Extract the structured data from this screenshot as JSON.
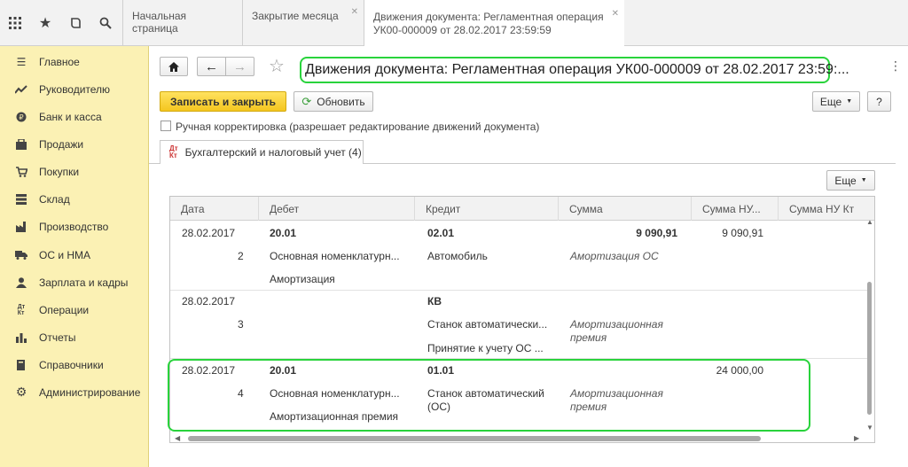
{
  "topbar": {
    "icons": [
      "apps-grid-icon",
      "star-icon",
      "history-icon",
      "search-icon"
    ],
    "tabs": [
      {
        "label": "Начальная страница",
        "closable": false,
        "active": false
      },
      {
        "label": "Закрытие месяца",
        "closable": true,
        "active": false
      },
      {
        "label": "Движения документа: Регламентная операция",
        "label2": "УК00-000009 от 28.02.2017 23:59:59",
        "closable": true,
        "active": true
      }
    ]
  },
  "sidebar": {
    "items": [
      {
        "label": "Главное",
        "icon": "menu-icon"
      },
      {
        "label": "Руководителю",
        "icon": "trend-icon"
      },
      {
        "label": "Банк и касса",
        "icon": "bank-icon"
      },
      {
        "label": "Продажи",
        "icon": "sales-icon"
      },
      {
        "label": "Покупки",
        "icon": "cart-icon"
      },
      {
        "label": "Склад",
        "icon": "warehouse-icon"
      },
      {
        "label": "Производство",
        "icon": "factory-icon"
      },
      {
        "label": "ОС и НМА",
        "icon": "truck-icon"
      },
      {
        "label": "Зарплата и кадры",
        "icon": "person-icon"
      },
      {
        "label": "Операции",
        "icon": "dt-kt-icon"
      },
      {
        "label": "Отчеты",
        "icon": "bar-chart-icon"
      },
      {
        "label": "Справочники",
        "icon": "book-icon"
      },
      {
        "label": "Администрирование",
        "icon": "gear-icon"
      }
    ]
  },
  "main": {
    "title": "Движения документа: Регламентная операция УК00-000009 от 28.02.2017 23:59:...",
    "save_label": "Записать и закрыть",
    "refresh_label": "Обновить",
    "more_label": "Еще",
    "help_label": "?",
    "checkbox_label": "Ручная корректировка (разрешает редактирование движений документа)",
    "checkbox_checked": false,
    "tab_label": "Бухгалтерский и налоговый учет (4)",
    "tab_icon_text": "Дт Кт",
    "table_more_label": "Еще"
  },
  "table": {
    "columns": [
      "Дата",
      "Дебет",
      "Кредит",
      "Сумма",
      "Сумма НУ...",
      "Сумма НУ Кт"
    ],
    "rows": [
      {
        "date": "28.02.2017",
        "num": "2",
        "debit_account": "20.01",
        "debit_sub1": "Основная номенклатурн...",
        "debit_sub2": "Амортизация",
        "credit_account": "02.01",
        "credit_sub1": "Автомобиль",
        "credit_sub2": "",
        "sum": "9 090,91",
        "sum_note": "Амортизация ОС",
        "sum_nu": "9 090,91",
        "sum_nu_kt": ""
      },
      {
        "date": "28.02.2017",
        "num": "3",
        "debit_account": "",
        "debit_sub1": "",
        "debit_sub2": "",
        "credit_account": "КВ",
        "credit_sub1": "Станок автоматически...",
        "credit_sub2": "Принятие к учету ОС ...",
        "sum": "",
        "sum_note": "Амортизационная премия",
        "sum_nu": "",
        "sum_nu_kt": ""
      },
      {
        "date": "28.02.2017",
        "num": "4",
        "debit_account": "20.01",
        "debit_sub1": "Основная номенклатурн...",
        "debit_sub2": "Амортизационная премия",
        "credit_account": "01.01",
        "credit_sub1": "Станок автоматический (ОС)",
        "credit_sub2": "",
        "sum": "",
        "sum_note": "Амортизационная премия",
        "sum_nu": "24 000,00",
        "sum_nu_kt": ""
      }
    ]
  },
  "colors": {
    "sidebar_bg": "#fbf1b4",
    "primary_button": "#f4c61f",
    "highlight": "#29d33c"
  }
}
